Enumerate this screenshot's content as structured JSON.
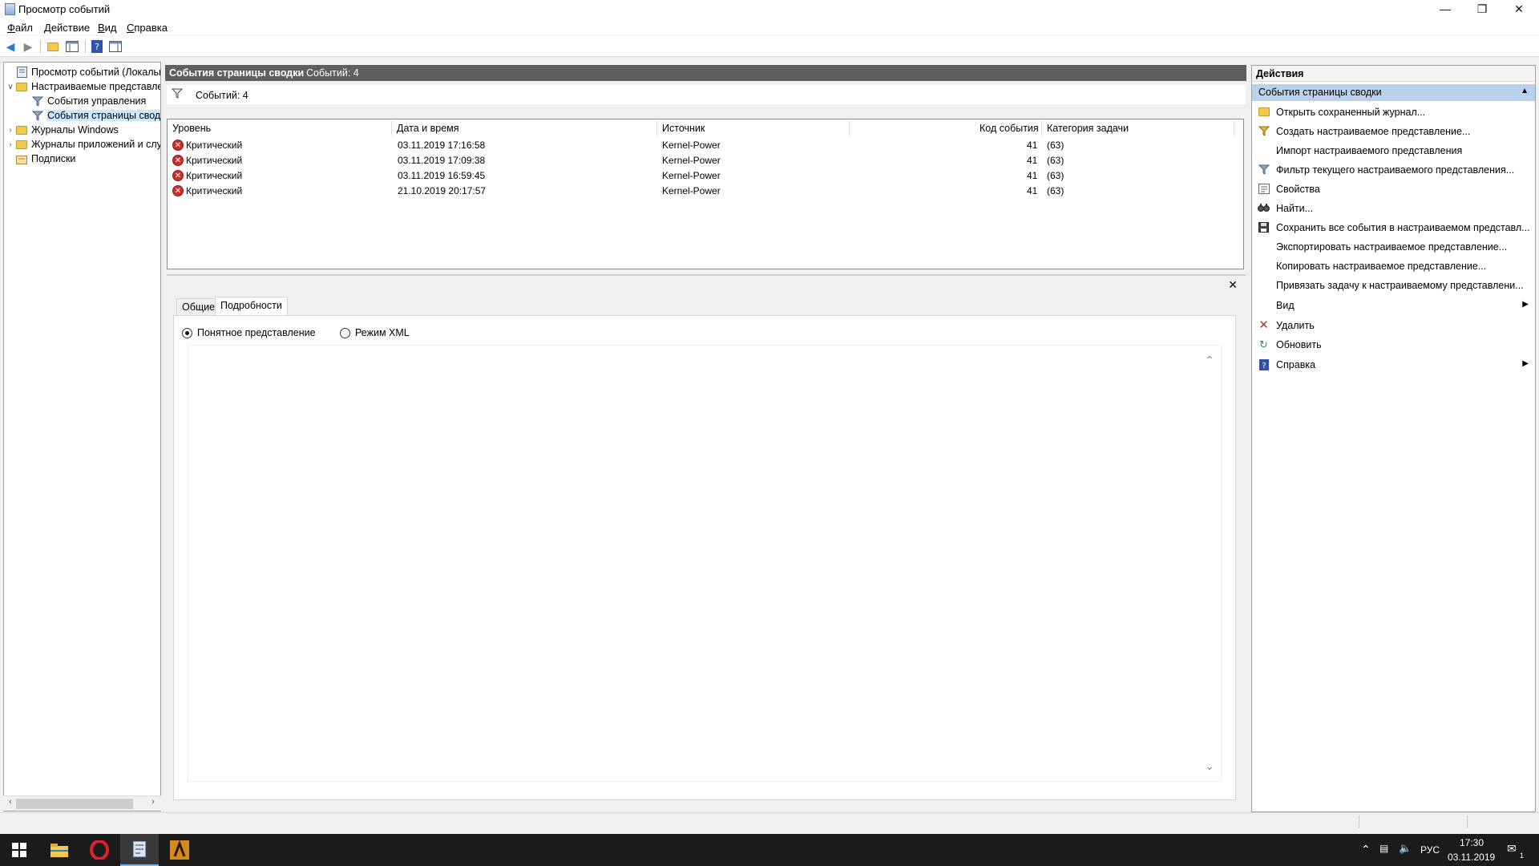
{
  "window": {
    "title": "Просмотр событий",
    "minimize": "—",
    "restore": "❐",
    "close": "✕"
  },
  "menu": [
    {
      "accel": "Ф",
      "rest": "айл"
    },
    {
      "accel": "Д",
      "rest": "ействие"
    },
    {
      "accel": "В",
      "rest": "ид"
    },
    {
      "accel": "С",
      "rest": "правка"
    }
  ],
  "tree": {
    "root": "Просмотр событий (Локальный)",
    "custom_views": "Настраиваемые представления",
    "admin_events": "События управления",
    "summary_events": "События страницы сводки",
    "windows_logs": "Журналы Windows",
    "app_logs": "Журналы приложений и служб",
    "subscriptions": "Подписки"
  },
  "center": {
    "header_title": "События страницы сводки",
    "header_count": "Событий: 4",
    "filter_text": "Событий: 4",
    "columns": [
      "Уровень",
      "Дата и время",
      "Источник",
      "Код события",
      "Категория задачи"
    ],
    "rows": [
      {
        "level": "Критический",
        "datetime": "03.11.2019 17:16:58",
        "source": "Kernel-Power",
        "code": "41",
        "category": "(63)"
      },
      {
        "level": "Критический",
        "datetime": "03.11.2019 17:09:38",
        "source": "Kernel-Power",
        "code": "41",
        "category": "(63)"
      },
      {
        "level": "Критический",
        "datetime": "03.11.2019 16:59:45",
        "source": "Kernel-Power",
        "code": "41",
        "category": "(63)"
      },
      {
        "level": "Критический",
        "datetime": "21.10.2019 20:17:57",
        "source": "Kernel-Power",
        "code": "41",
        "category": "(63)"
      }
    ]
  },
  "details": {
    "tab_general": "Общие",
    "tab_details": "Подробности",
    "radio_friendly": "Понятное представление",
    "radio_xml": "Режим XML"
  },
  "actions": {
    "header": "Действия",
    "section": "События страницы сводки",
    "items": [
      "Открыть сохраненный журнал...",
      "Создать настраиваемое представление...",
      "Импорт настраиваемого представления",
      "Фильтр текущего настраиваемого представления...",
      "Свойства",
      "Найти...",
      "Сохранить все события в настраиваемом представл...",
      "Экспортировать настраиваемое представление...",
      "Копировать настраиваемое представление...",
      "Привязать задачу к настраиваемому представлени...",
      "Вид",
      "Удалить",
      "Обновить",
      "Справка"
    ]
  },
  "taskbar": {
    "lang": "РУС",
    "time": "17:30",
    "date": "03.11.2019",
    "notif_count": "1"
  },
  "colors": {
    "accent": "#b9d1ea",
    "header_bg": "#5f5f5f",
    "critical": "#c9302c",
    "taskbar": "#1b1b1b"
  }
}
